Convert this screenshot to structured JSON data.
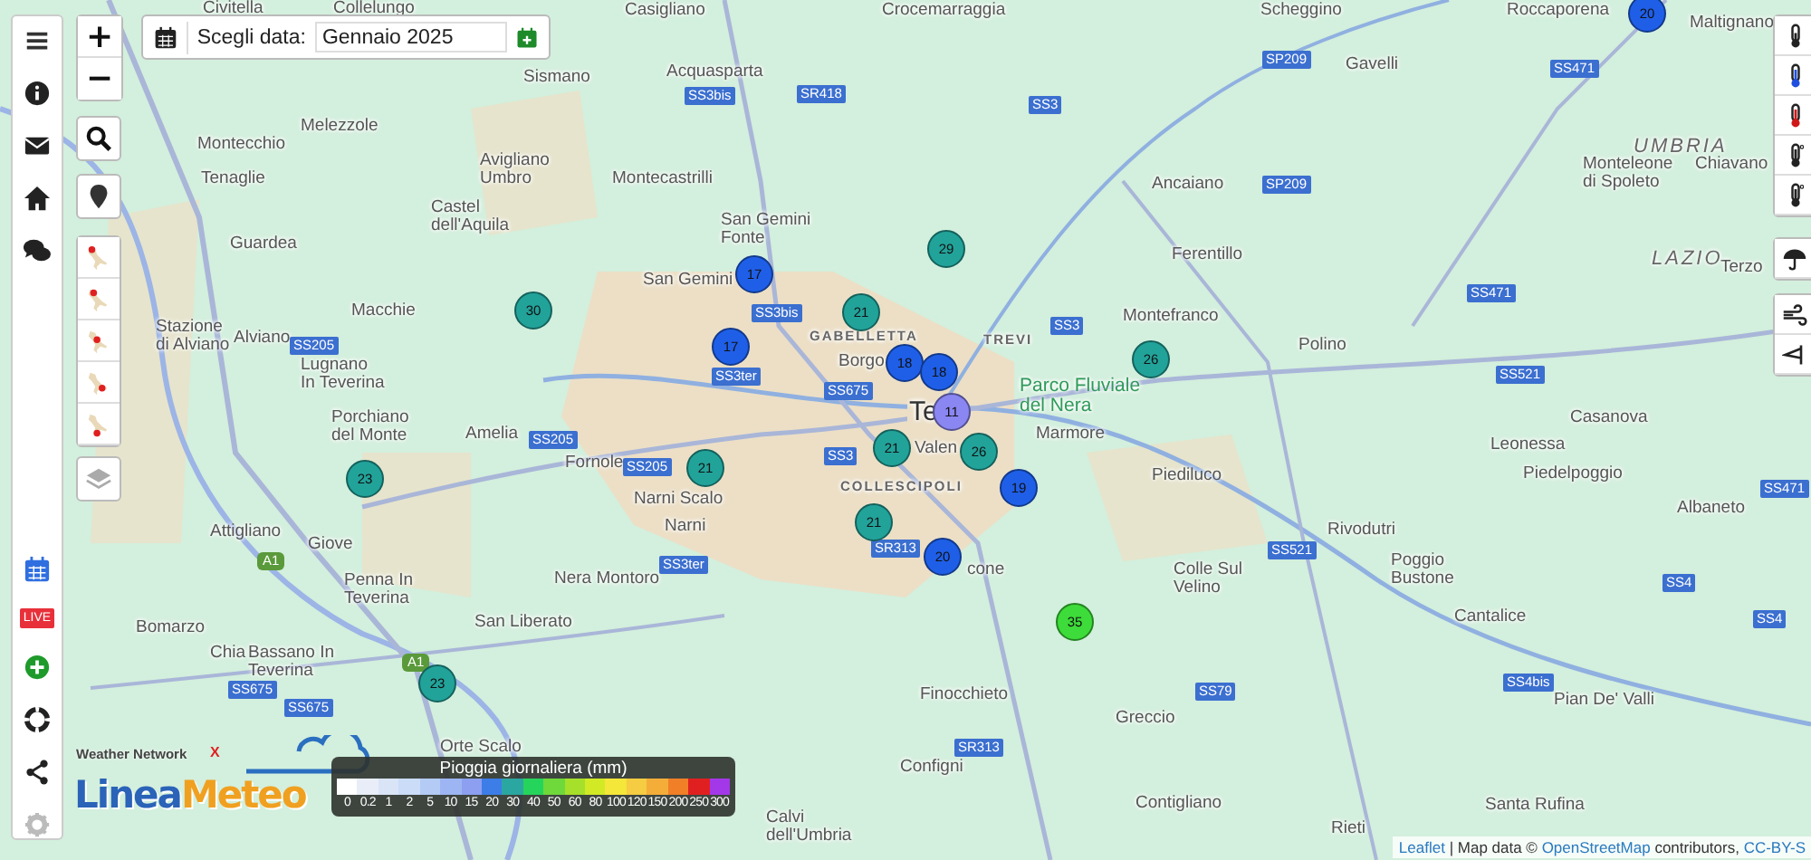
{
  "date_picker": {
    "label": "Scegli data:",
    "value": "Gennaio 2025"
  },
  "sidebar": {
    "live_badge": "LIVE",
    "settings_disabled": true
  },
  "zoom": {
    "in": "+",
    "out": "−"
  },
  "map_labels": [
    {
      "kind": "place",
      "text": "Civitella"
    },
    {
      "kind": "place",
      "text": "Collelungo"
    },
    {
      "kind": "place",
      "text": "Casigliano"
    },
    {
      "kind": "place",
      "text": "Crocemarraggia"
    },
    {
      "kind": "place",
      "text": "Scheggino"
    },
    {
      "kind": "place",
      "text": "Roccaporena"
    },
    {
      "kind": "place",
      "text": "Maltignano"
    },
    {
      "kind": "place",
      "text": "Acquasparta"
    },
    {
      "kind": "place",
      "text": "Gavelli"
    },
    {
      "kind": "place",
      "text": "Sismano"
    },
    {
      "kind": "place",
      "text": "Chiavano"
    },
    {
      "kind": "place",
      "text": "Montecchio"
    },
    {
      "kind": "place",
      "text": "Melezzole"
    },
    {
      "kind": "place",
      "text": "Tenaglie"
    },
    {
      "kind": "place",
      "text": "Avigliano\nUmbro"
    },
    {
      "kind": "place",
      "text": "Montecastrilli"
    },
    {
      "kind": "place",
      "text": "Castel\ndell'Aquila"
    },
    {
      "kind": "place",
      "text": "Guardea"
    },
    {
      "kind": "place",
      "text": "San Gemini\nFonte"
    },
    {
      "kind": "place",
      "text": "Ancaiano"
    },
    {
      "kind": "place",
      "text": "Monteleone\ndi Spoleto"
    },
    {
      "kind": "place",
      "text": "Ferentillo"
    },
    {
      "kind": "place",
      "text": "Macchie"
    },
    {
      "kind": "place",
      "text": "Stazione\ndi Alviano"
    },
    {
      "kind": "place",
      "text": "Alviano"
    },
    {
      "kind": "place",
      "text": "Lugnano\nIn Teverina"
    },
    {
      "kind": "place",
      "text": "San Gemini"
    },
    {
      "kind": "place",
      "text": "Borgo"
    },
    {
      "kind": "place",
      "text": "Montefranco"
    },
    {
      "kind": "place",
      "text": "Polino"
    },
    {
      "kind": "park",
      "text": "Parco Fluviale\ndel Nera"
    },
    {
      "kind": "place",
      "text": "Marmore"
    },
    {
      "kind": "city",
      "text": "Te"
    },
    {
      "kind": "place",
      "text": "Valen"
    },
    {
      "kind": "place",
      "text": "Amelia"
    },
    {
      "kind": "place",
      "text": "Fornole"
    },
    {
      "kind": "place",
      "text": "Narni Scalo"
    },
    {
      "kind": "place",
      "text": "Narni"
    },
    {
      "kind": "place",
      "text": "Piediluco"
    },
    {
      "kind": "place",
      "text": "Casanova"
    },
    {
      "kind": "place",
      "text": "Leonessa"
    },
    {
      "kind": "place",
      "text": "Piedelpoggio"
    },
    {
      "kind": "place",
      "text": "Albaneto"
    },
    {
      "kind": "place",
      "text": "Porchiano\ndel Monte"
    },
    {
      "kind": "place",
      "text": "Giove"
    },
    {
      "kind": "place",
      "text": "Penna In\nTeverina"
    },
    {
      "kind": "place",
      "text": "Attigliano"
    },
    {
      "kind": "place",
      "text": "Nera Montoro"
    },
    {
      "kind": "place",
      "text": "Rivodutri"
    },
    {
      "kind": "place",
      "text": "cone"
    },
    {
      "kind": "place",
      "text": "Colle Sul\nVelino"
    },
    {
      "kind": "place",
      "text": "Poggio\nBustone"
    },
    {
      "kind": "place",
      "text": "Terzo"
    },
    {
      "kind": "place",
      "text": "Bomarzo"
    },
    {
      "kind": "place",
      "text": "Chia"
    },
    {
      "kind": "place",
      "text": "Bassano In\nTeverina"
    },
    {
      "kind": "place",
      "text": "San Liberato"
    },
    {
      "kind": "place",
      "text": "Cantalice"
    },
    {
      "kind": "place",
      "text": "Finocchieto"
    },
    {
      "kind": "place",
      "text": "Pian De' Valli"
    },
    {
      "kind": "place",
      "text": "Greccio"
    },
    {
      "kind": "place",
      "text": "Orte Scalo"
    },
    {
      "kind": "place",
      "text": "Configni"
    },
    {
      "kind": "place",
      "text": "Contigliano"
    },
    {
      "kind": "place",
      "text": "Santa Rufina"
    },
    {
      "kind": "place",
      "text": "Calvi\ndell'Umbria"
    },
    {
      "kind": "place",
      "text": "Rieti"
    },
    {
      "kind": "district",
      "text": "GABELLETTA"
    },
    {
      "kind": "district",
      "text": "TREVI"
    },
    {
      "kind": "district",
      "text": "COLLESCIPOLI"
    },
    {
      "kind": "region",
      "text": "UMBRIA"
    },
    {
      "kind": "region",
      "text": "LAZIO"
    },
    {
      "kind": "road",
      "text": "SR418"
    },
    {
      "kind": "road",
      "text": "SS3bis"
    },
    {
      "kind": "road",
      "text": "SS3"
    },
    {
      "kind": "road",
      "text": "SP209"
    },
    {
      "kind": "road",
      "text": "SP209"
    },
    {
      "kind": "road",
      "text": "SS471"
    },
    {
      "kind": "road",
      "text": "SS3bis"
    },
    {
      "kind": "road",
      "text": "SS3"
    },
    {
      "kind": "road",
      "text": "SS471"
    },
    {
      "kind": "road",
      "text": "SS3ter"
    },
    {
      "kind": "road",
      "text": "SS675"
    },
    {
      "kind": "road",
      "text": "SS205"
    },
    {
      "kind": "road",
      "text": "SS521"
    },
    {
      "kind": "road",
      "text": "SS205"
    },
    {
      "kind": "road",
      "text": "SS3"
    },
    {
      "kind": "road",
      "text": "SS205"
    },
    {
      "kind": "road",
      "text": "SS471"
    },
    {
      "kind": "road",
      "text": "SR313"
    },
    {
      "kind": "road",
      "text": "SS521"
    },
    {
      "kind": "motorway",
      "text": "A1"
    },
    {
      "kind": "road",
      "text": "SS3ter"
    },
    {
      "kind": "road",
      "text": "SS4"
    },
    {
      "kind": "road",
      "text": "SS4"
    },
    {
      "kind": "motorway",
      "text": "A1"
    },
    {
      "kind": "road",
      "text": "SS4bis"
    },
    {
      "kind": "road",
      "text": "SS675"
    },
    {
      "kind": "road",
      "text": "SS675"
    },
    {
      "kind": "road",
      "text": "SS79"
    },
    {
      "kind": "road",
      "text": "SR313"
    }
  ],
  "markers": [
    {
      "value": "20",
      "color": "#1f5fe8"
    },
    {
      "value": "29",
      "color": "#22a39a"
    },
    {
      "value": "17",
      "color": "#1f5fe8"
    },
    {
      "value": "30",
      "color": "#22a39a"
    },
    {
      "value": "21",
      "color": "#22a39a"
    },
    {
      "value": "17",
      "color": "#1f5fe8"
    },
    {
      "value": "18",
      "color": "#1f5fe8"
    },
    {
      "value": "26",
      "color": "#22a39a"
    },
    {
      "value": "18",
      "color": "#1f5fe8"
    },
    {
      "value": "11",
      "color": "#8a86f2"
    },
    {
      "value": "26",
      "color": "#22a39a"
    },
    {
      "value": "21",
      "color": "#22a39a"
    },
    {
      "value": "21",
      "color": "#22a39a"
    },
    {
      "value": "23",
      "color": "#22a39a"
    },
    {
      "value": "19",
      "color": "#1f5fe8"
    },
    {
      "value": "21",
      "color": "#22a39a"
    },
    {
      "value": "20",
      "color": "#1f5fe8"
    },
    {
      "value": "35",
      "color": "#3ddc3a"
    },
    {
      "value": "23",
      "color": "#22a39a"
    }
  ],
  "legend": {
    "title": "Pioggia giornaliera (mm)",
    "scale": [
      {
        "label": "0",
        "color": "#ffffff"
      },
      {
        "label": "0.2",
        "color": "#e8edf8"
      },
      {
        "label": "1",
        "color": "#dae4f7"
      },
      {
        "label": "2",
        "color": "#cadcf7"
      },
      {
        "label": "5",
        "color": "#b4cbf5"
      },
      {
        "label": "10",
        "color": "#9db5f2"
      },
      {
        "label": "15",
        "color": "#8c9ff0"
      },
      {
        "label": "20",
        "color": "#3c7de8"
      },
      {
        "label": "30",
        "color": "#2aa7a0"
      },
      {
        "label": "40",
        "color": "#25d45a"
      },
      {
        "label": "50",
        "color": "#6fd83a"
      },
      {
        "label": "60",
        "color": "#a6e02a"
      },
      {
        "label": "80",
        "color": "#d2ea25"
      },
      {
        "label": "100",
        "color": "#f5e63a"
      },
      {
        "label": "120",
        "color": "#f5cc42"
      },
      {
        "label": "150",
        "color": "#f5ad3a"
      },
      {
        "label": "200",
        "color": "#f07f28"
      },
      {
        "label": "250",
        "color": "#e02020"
      },
      {
        "label": "300",
        "color": "#a338e8"
      }
    ]
  },
  "logo": {
    "tagline": "Weather Network",
    "mark": "X",
    "name_part1": "Linea",
    "name_part2": "Meteo"
  },
  "attribution": {
    "link1": "Leaflet",
    "text1": " | Map data © ",
    "link2": "OpenStreetMap",
    "text2": " contributors, ",
    "link3": "CC-BY-S"
  }
}
